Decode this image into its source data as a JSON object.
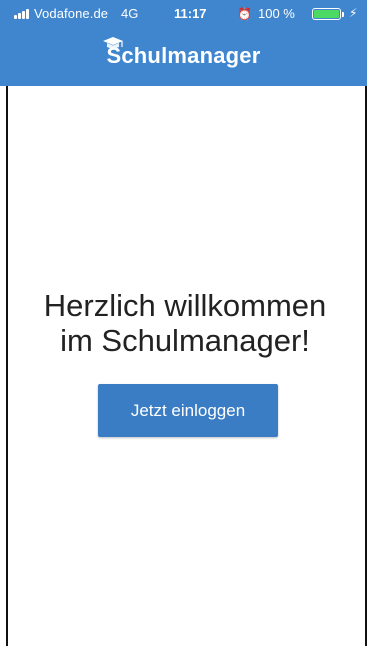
{
  "status_bar": {
    "carrier": "Vodafone.de",
    "network": "4G",
    "time": "11:17",
    "battery_percent": "100 %",
    "battery_level": 1.0,
    "alarm_icon": "alarm-clock-icon",
    "charging_icon": "lightning-bolt-icon"
  },
  "header": {
    "title": "Schulmanager",
    "logo_icon": "graduation-cap-icon",
    "background": "#3f86cf"
  },
  "main": {
    "welcome_line1": "Herzlich willkommen",
    "welcome_line2": "im Schulmanager!",
    "login_button": "Jetzt einloggen",
    "button_color": "#3a7dc4"
  }
}
